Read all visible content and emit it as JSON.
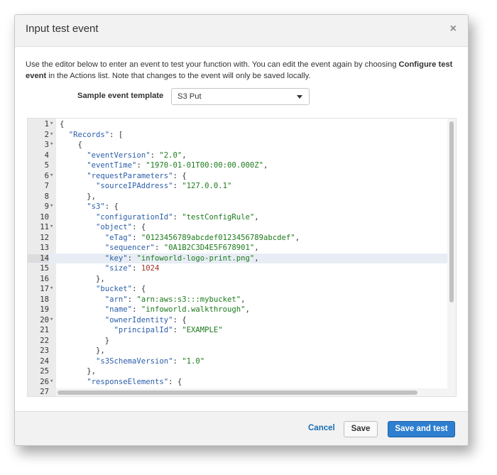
{
  "dialog": {
    "title": "Input test event",
    "close_label": "×",
    "description_part1": "Use the editor below to enter an event to test your function with. You can edit the event again by choosing ",
    "description_bold": "Configure test event",
    "description_part2": " in the Actions list. Note that changes to the event will only be saved locally."
  },
  "template": {
    "label": "Sample event template",
    "selected": "S3 Put"
  },
  "editor": {
    "active_line": 14,
    "lines": [
      {
        "n": "1",
        "fold": true,
        "code": [
          {
            "t": "p",
            "v": "{"
          }
        ]
      },
      {
        "n": "2",
        "fold": true,
        "code": [
          {
            "t": "p",
            "v": "  "
          },
          {
            "t": "k",
            "v": "\"Records\""
          },
          {
            "t": "p",
            "v": ": ["
          }
        ]
      },
      {
        "n": "3",
        "fold": true,
        "code": [
          {
            "t": "p",
            "v": "    {"
          }
        ]
      },
      {
        "n": "4",
        "fold": false,
        "code": [
          {
            "t": "p",
            "v": "      "
          },
          {
            "t": "k",
            "v": "\"eventVersion\""
          },
          {
            "t": "p",
            "v": ": "
          },
          {
            "t": "s",
            "v": "\"2.0\""
          },
          {
            "t": "p",
            "v": ","
          }
        ]
      },
      {
        "n": "5",
        "fold": false,
        "code": [
          {
            "t": "p",
            "v": "      "
          },
          {
            "t": "k",
            "v": "\"eventTime\""
          },
          {
            "t": "p",
            "v": ": "
          },
          {
            "t": "s",
            "v": "\"1970-01-01T00:00:00.000Z\""
          },
          {
            "t": "p",
            "v": ","
          }
        ]
      },
      {
        "n": "6",
        "fold": true,
        "code": [
          {
            "t": "p",
            "v": "      "
          },
          {
            "t": "k",
            "v": "\"requestParameters\""
          },
          {
            "t": "p",
            "v": ": {"
          }
        ]
      },
      {
        "n": "7",
        "fold": false,
        "code": [
          {
            "t": "p",
            "v": "        "
          },
          {
            "t": "k",
            "v": "\"sourceIPAddress\""
          },
          {
            "t": "p",
            "v": ": "
          },
          {
            "t": "s",
            "v": "\"127.0.0.1\""
          }
        ]
      },
      {
        "n": "8",
        "fold": false,
        "code": [
          {
            "t": "p",
            "v": "      },"
          }
        ]
      },
      {
        "n": "9",
        "fold": true,
        "code": [
          {
            "t": "p",
            "v": "      "
          },
          {
            "t": "k",
            "v": "\"s3\""
          },
          {
            "t": "p",
            "v": ": {"
          }
        ]
      },
      {
        "n": "10",
        "fold": false,
        "code": [
          {
            "t": "p",
            "v": "        "
          },
          {
            "t": "k",
            "v": "\"configurationId\""
          },
          {
            "t": "p",
            "v": ": "
          },
          {
            "t": "s",
            "v": "\"testConfigRule\""
          },
          {
            "t": "p",
            "v": ","
          }
        ]
      },
      {
        "n": "11",
        "fold": true,
        "code": [
          {
            "t": "p",
            "v": "        "
          },
          {
            "t": "k",
            "v": "\"object\""
          },
          {
            "t": "p",
            "v": ": {"
          }
        ]
      },
      {
        "n": "12",
        "fold": false,
        "code": [
          {
            "t": "p",
            "v": "          "
          },
          {
            "t": "k",
            "v": "\"eTag\""
          },
          {
            "t": "p",
            "v": ": "
          },
          {
            "t": "s",
            "v": "\"0123456789abcdef0123456789abcdef\""
          },
          {
            "t": "p",
            "v": ","
          }
        ]
      },
      {
        "n": "13",
        "fold": false,
        "code": [
          {
            "t": "p",
            "v": "          "
          },
          {
            "t": "k",
            "v": "\"sequencer\""
          },
          {
            "t": "p",
            "v": ": "
          },
          {
            "t": "s",
            "v": "\"0A1B2C3D4E5F678901\""
          },
          {
            "t": "p",
            "v": ","
          }
        ]
      },
      {
        "n": "14",
        "fold": false,
        "code": [
          {
            "t": "p",
            "v": "          "
          },
          {
            "t": "k",
            "v": "\"key\""
          },
          {
            "t": "p",
            "v": ": "
          },
          {
            "t": "s",
            "v": "\"infoworld-logo-print.png\""
          },
          {
            "t": "p",
            "v": ","
          }
        ]
      },
      {
        "n": "15",
        "fold": false,
        "code": [
          {
            "t": "p",
            "v": "          "
          },
          {
            "t": "k",
            "v": "\"size\""
          },
          {
            "t": "p",
            "v": ": "
          },
          {
            "t": "n",
            "v": "1024"
          }
        ]
      },
      {
        "n": "16",
        "fold": false,
        "code": [
          {
            "t": "p",
            "v": "        },"
          }
        ]
      },
      {
        "n": "17",
        "fold": true,
        "code": [
          {
            "t": "p",
            "v": "        "
          },
          {
            "t": "k",
            "v": "\"bucket\""
          },
          {
            "t": "p",
            "v": ": {"
          }
        ]
      },
      {
        "n": "18",
        "fold": false,
        "code": [
          {
            "t": "p",
            "v": "          "
          },
          {
            "t": "k",
            "v": "\"arn\""
          },
          {
            "t": "p",
            "v": ": "
          },
          {
            "t": "s",
            "v": "\"arn:aws:s3:::mybucket\""
          },
          {
            "t": "p",
            "v": ","
          }
        ]
      },
      {
        "n": "19",
        "fold": false,
        "code": [
          {
            "t": "p",
            "v": "          "
          },
          {
            "t": "k",
            "v": "\"name\""
          },
          {
            "t": "p",
            "v": ": "
          },
          {
            "t": "s",
            "v": "\"infoworld.walkthrough\""
          },
          {
            "t": "p",
            "v": ","
          }
        ]
      },
      {
        "n": "20",
        "fold": true,
        "code": [
          {
            "t": "p",
            "v": "          "
          },
          {
            "t": "k",
            "v": "\"ownerIdentity\""
          },
          {
            "t": "p",
            "v": ": {"
          }
        ]
      },
      {
        "n": "21",
        "fold": false,
        "code": [
          {
            "t": "p",
            "v": "            "
          },
          {
            "t": "k",
            "v": "\"principalId\""
          },
          {
            "t": "p",
            "v": ": "
          },
          {
            "t": "s",
            "v": "\"EXAMPLE\""
          }
        ]
      },
      {
        "n": "22",
        "fold": false,
        "code": [
          {
            "t": "p",
            "v": "          }"
          }
        ]
      },
      {
        "n": "23",
        "fold": false,
        "code": [
          {
            "t": "p",
            "v": "        },"
          }
        ]
      },
      {
        "n": "24",
        "fold": false,
        "code": [
          {
            "t": "p",
            "v": "        "
          },
          {
            "t": "k",
            "v": "\"s3SchemaVersion\""
          },
          {
            "t": "p",
            "v": ": "
          },
          {
            "t": "s",
            "v": "\"1.0\""
          }
        ]
      },
      {
        "n": "25",
        "fold": false,
        "code": [
          {
            "t": "p",
            "v": "      },"
          }
        ]
      },
      {
        "n": "26",
        "fold": true,
        "code": [
          {
            "t": "p",
            "v": "      "
          },
          {
            "t": "k",
            "v": "\"responseElements\""
          },
          {
            "t": "p",
            "v": ": {"
          }
        ]
      },
      {
        "n": "27",
        "fold": false,
        "code": []
      }
    ]
  },
  "footer": {
    "cancel_label": "Cancel",
    "save_label": "Save",
    "save_and_test_label": "Save and test"
  },
  "colors": {
    "primary_button": "#2f7fd0",
    "link": "#1b6eb5",
    "json_key": "#2b5ea8",
    "json_string": "#1c7a1c",
    "json_number": "#a33124"
  }
}
